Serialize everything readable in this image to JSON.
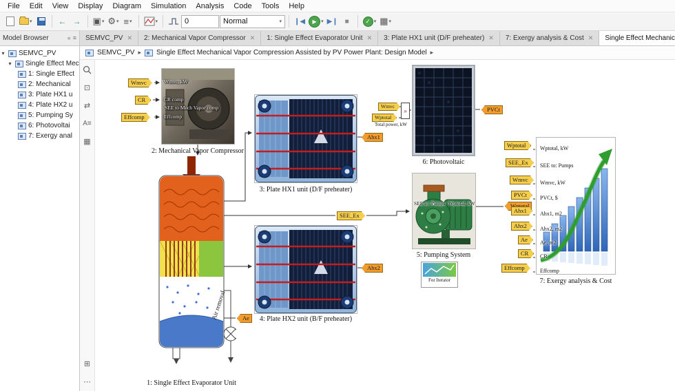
{
  "menubar": {
    "items": [
      "File",
      "Edit",
      "View",
      "Display",
      "Diagram",
      "Simulation",
      "Analysis",
      "Code",
      "Tools",
      "Help"
    ]
  },
  "toolbar": {
    "stop_time": "0",
    "sim_mode": "Normal"
  },
  "panel": {
    "header": "Model Browser"
  },
  "tabs": [
    "SEMVC_PV",
    "2: Mechanical Vapor Compressor",
    "1: Single Effect Evaporator Unit",
    "3: Plate HX1 unit (D/F preheater)",
    "7: Exergy analysis & Cost",
    "Single Effect Mechanical Vapor Compression Assisted by"
  ],
  "tree": {
    "root": "SEMVC_PV",
    "model": "Single Effect Mecha",
    "children": [
      "1: Single Effect",
      "2: Mechanical",
      "3: Plate HX1 u",
      "4: Plate HX2 u",
      "5: Pumping Sy",
      "6: Photovoltai",
      "7: Exergy anal"
    ]
  },
  "breadcrumb": {
    "root": "SEMVC_PV",
    "current": "Single Effect Mechanical Vapor Compression Assisted by PV Power Plant: Design Model"
  },
  "diagram": {
    "compressor": {
      "caption": "2: Mechanical Vapor Compressor",
      "label_wmvc": "Wmvc, kW",
      "label_cr": "CR comp",
      "label_see": "SEE to Mech Vapor comp",
      "label_eff": "Effcomp",
      "tag_wmvc": "Wmvc",
      "tag_cr": "CR",
      "tag_eff": "Effcomp"
    },
    "hx1": {
      "caption": "3: Plate HX1 unit (D/F preheater)",
      "tag_out": "Ahx1"
    },
    "hx2": {
      "caption": "4: Plate HX2 unit (B/F preheater)",
      "tag_out": "Ahx2",
      "tag_ae": "Ae"
    },
    "evaporator": {
      "caption": "1: Single Effect Evaporator Unit",
      "air_label": "Air removal"
    },
    "pv": {
      "caption": "6: Photovoltaic",
      "tag_in1": "Wmvc",
      "tag_in2": "Wptotal",
      "total_label": "Total power, kW",
      "tag_out": "PVCt"
    },
    "pump": {
      "caption": "5: Pumping System",
      "port_in": "SEE to: Pumps",
      "port_out": "Wptotal, kW",
      "tag_in": "SEE_Ex",
      "tag_out": "Wptotal"
    },
    "iterator": {
      "caption": "For Iterator"
    },
    "exergy": {
      "caption": "7: Exergy analysis & Cost",
      "ports": [
        {
          "tag": "Wptotal",
          "label": "Wptotal, kW"
        },
        {
          "tag": "SEE_Ex",
          "label": "SEE to: Pumps"
        },
        {
          "tag": "Wmvc",
          "label": "Wmvc, kW"
        },
        {
          "tag": "PVCt",
          "label": "PVCt, $"
        },
        {
          "tag": "Ahx1",
          "label": "Ahx1, m2"
        },
        {
          "tag": "Ahx2",
          "label": "Ahx2, m2"
        },
        {
          "tag": "Ae",
          "label": "Ae, m2"
        },
        {
          "tag": "CR",
          "label": "CR"
        },
        {
          "tag": "Effcomp",
          "label": "Effcomp"
        }
      ]
    }
  },
  "colors": {
    "tag_from": "#F5CE4D",
    "tag_goto": "#F29B2E",
    "run_green": "#4DA54D",
    "wire": "#333333"
  }
}
